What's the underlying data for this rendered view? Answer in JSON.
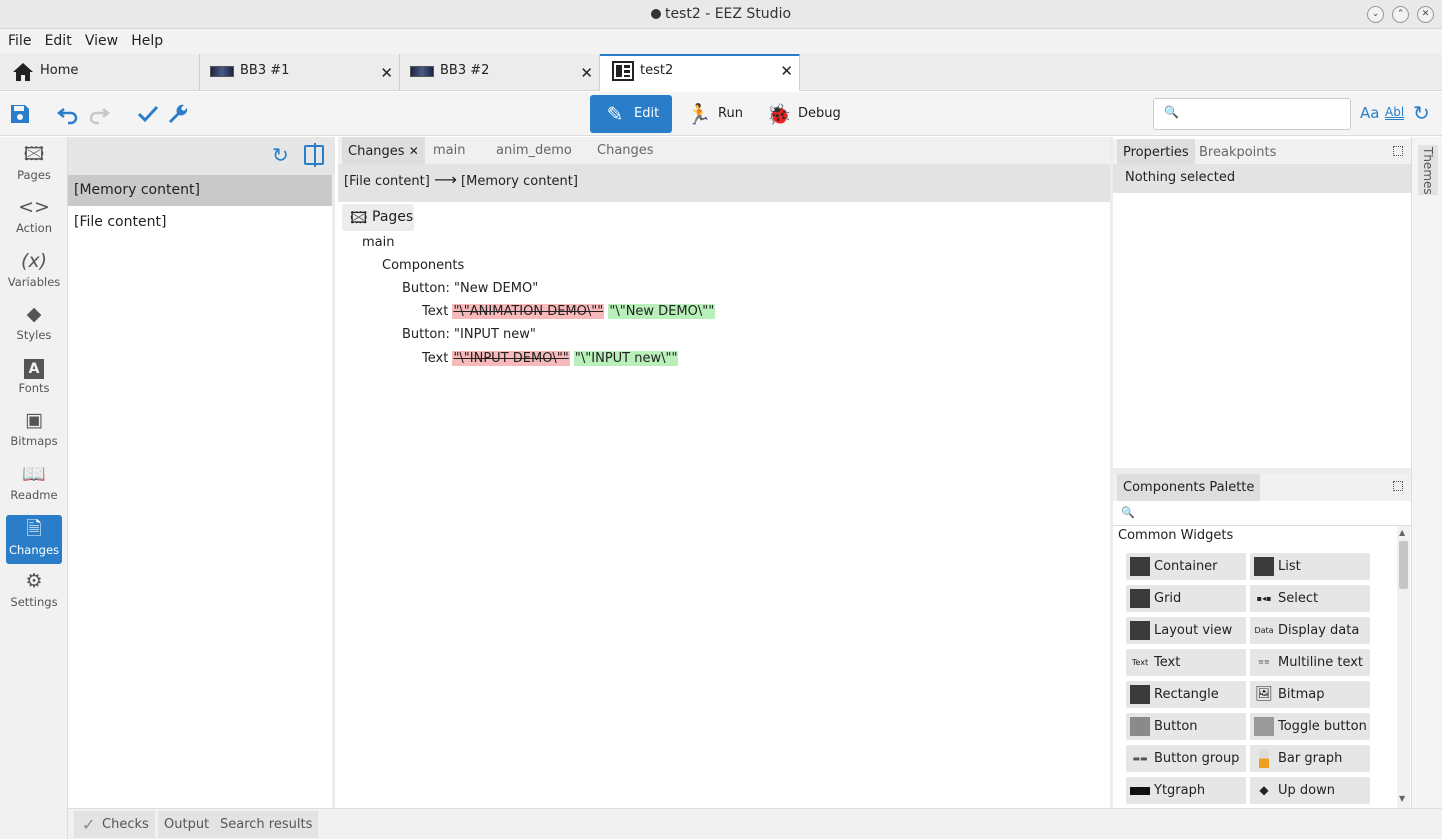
{
  "window": {
    "title": "test2 - EEZ Studio",
    "buttons": {
      "minimize": "⌄",
      "maximize": "⌃",
      "close": "✕"
    }
  },
  "menu": [
    "File",
    "Edit",
    "View",
    "Help"
  ],
  "tabs": [
    {
      "label": "Home",
      "close": ""
    },
    {
      "label": "BB3 #1",
      "close": "✕"
    },
    {
      "label": "BB3 #2",
      "close": "✕"
    },
    {
      "label": "test2",
      "close": "✕"
    }
  ],
  "toolbar": {
    "modes": {
      "edit": "Edit",
      "run": "Run",
      "debug": "Debug"
    },
    "search_placeholder": "",
    "match_case": "Aa",
    "whole_word": "Abl"
  },
  "leftnav": [
    "Pages",
    "Action",
    "Variables",
    "Styles",
    "Fonts",
    "Bitmaps",
    "Readme",
    "Changes",
    "Settings"
  ],
  "changes_list": [
    "[Memory content]",
    "[File content]"
  ],
  "center": {
    "tabs": [
      "Changes",
      "main",
      "anim_demo",
      "Changes"
    ],
    "diff_from": "[File content]",
    "diff_to": "[Memory content]",
    "pages_label": "Pages",
    "tree": {
      "page": "main",
      "components": "Components",
      "button1": "Button: \"New DEMO\"",
      "text_label": "Text",
      "button1_old": "\"\\\"ANIMATION DEMO\\\"\"",
      "button1_new": "\"\\\"New DEMO\\\"\"",
      "button2": "Button: \"INPUT new\"",
      "button2_old": "\"\\\"INPUT DEMO\\\"\"",
      "button2_new": "\"\\\"INPUT new\\\"\""
    }
  },
  "properties": {
    "tabs": [
      "Properties",
      "Breakpoints"
    ],
    "empty": "Nothing selected"
  },
  "palette": {
    "title": "Components Palette",
    "search_placeholder": "",
    "section": "Common Widgets",
    "widgets": [
      "Container",
      "List",
      "Grid",
      "Select",
      "Layout view",
      "Display data",
      "Text",
      "Multiline text",
      "Rectangle",
      "Bitmap",
      "Button",
      "Toggle button",
      "Button group",
      "Bar graph",
      "Ytgraph",
      "Up down"
    ],
    "icon_text": {
      "display_data": "Data",
      "text": "Text"
    }
  },
  "themes_label": "Themes",
  "bottom_tabs": [
    "Checks",
    "Output",
    "Search results"
  ],
  "colors": {
    "accent": "#2a7ec9",
    "deleted_bg": "#f7b9b9",
    "added_bg": "#b9f0b9"
  }
}
